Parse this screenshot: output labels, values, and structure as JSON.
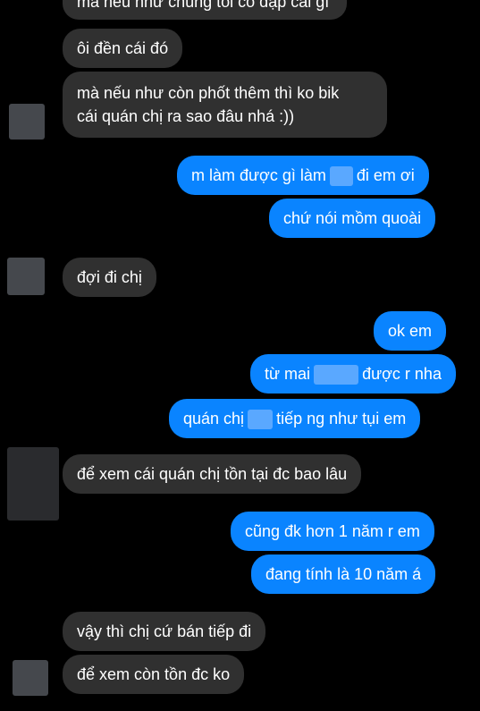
{
  "messages": [
    {
      "id": "m0",
      "side": "in",
      "text": "mà nếu như chúng tôi có đập cái gì"
    },
    {
      "id": "m1",
      "side": "in",
      "text": "ôi đền cái đó"
    },
    {
      "id": "m2",
      "side": "in",
      "line1": "mà nếu như còn phốt thêm thì ko bik",
      "line2": "cái quán chị ra sao đâu nhá :))"
    },
    {
      "id": "m3",
      "side": "out",
      "before": "m làm được gì làm",
      "after": "đi em ơi"
    },
    {
      "id": "m4",
      "side": "out",
      "text": "chứ nói mồm quoài"
    },
    {
      "id": "m5",
      "side": "in",
      "text": "đợi đi chị"
    },
    {
      "id": "m6",
      "side": "out",
      "text": "ok em"
    },
    {
      "id": "m7",
      "side": "out",
      "before": "từ mai",
      "after": "được r nha"
    },
    {
      "id": "m8",
      "side": "out",
      "before": "quán chị",
      "after": "tiếp ng như tụi em"
    },
    {
      "id": "m9",
      "side": "in",
      "text": "để xem cái quán chị tồn tại đc bao lâu"
    },
    {
      "id": "m10",
      "side": "out",
      "text": "cũng đk hơn 1 năm r em"
    },
    {
      "id": "m11",
      "side": "out",
      "text": "đang tính là 10 năm á"
    },
    {
      "id": "m12",
      "side": "in",
      "text": "vậy thì chị cứ bán tiếp đi"
    },
    {
      "id": "m13",
      "side": "in",
      "text": "để xem còn tồn đc ko"
    }
  ],
  "colors": {
    "incoming": "#303030",
    "outgoing": "#0a84ff",
    "background": "#000000"
  }
}
